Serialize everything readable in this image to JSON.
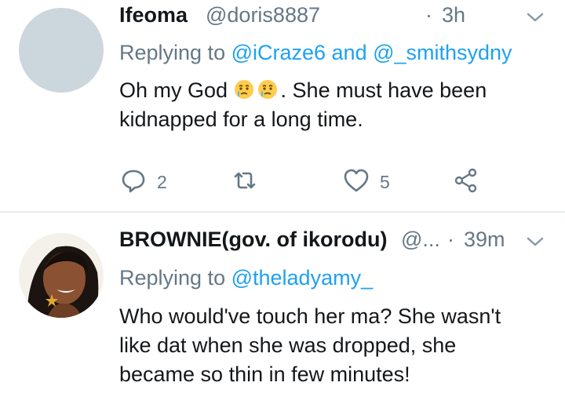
{
  "tweets": [
    {
      "name": "Ifeoma",
      "handle": "@doris8887",
      "separator": "·",
      "time": "3h",
      "replying_prefix": "Replying to ",
      "replying_to": "@iCraze6 and @_smithsydny",
      "text_before_emoji": "Oh my God ",
      "emojis": [
        "crying-face-emoji",
        "crying-face-emoji"
      ],
      "text_after_emoji": ". She must have been kidnapped for a long time.",
      "reply_count": "2",
      "retweet_count": "",
      "like_count": "5",
      "avatar_color": "#ccd6dd"
    },
    {
      "name": "BROWNIE(gov. of ikorodu)",
      "handle": "@...",
      "separator": "·",
      "time": "39m",
      "replying_prefix": "Replying to ",
      "replying_to": "@theladyamy_",
      "text": "Who would've touch her ma? She wasn't like dat when she was dropped, she became so thin in few minutes!"
    }
  ],
  "colors": {
    "text": "#14171a",
    "secondary": "#657786",
    "link": "#1da1f2",
    "divider": "#e6ecf0"
  },
  "icons": [
    "reply-icon",
    "retweet-icon",
    "like-icon",
    "share-icon",
    "chevron-down-icon"
  ]
}
